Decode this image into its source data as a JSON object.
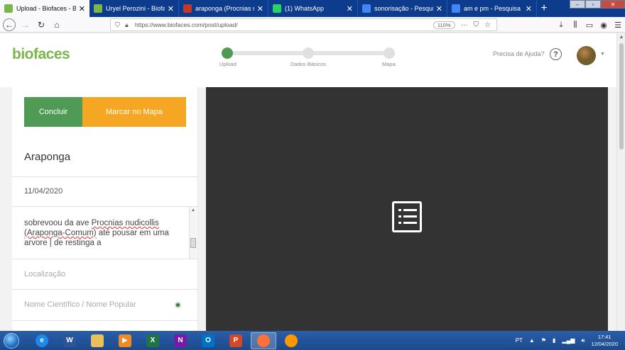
{
  "browser": {
    "tabs": [
      {
        "title": "Upload - Biofaces - Bring",
        "icon": "biofaces-favicon",
        "color": "#7bb64a",
        "active": true
      },
      {
        "title": "Uryel Perozini - Biofaces",
        "icon": "biofaces-favicon",
        "color": "#7bb64a",
        "active": false
      },
      {
        "title": "araponga (Procnias nudic",
        "icon": "bird-favicon",
        "color": "#c0392b",
        "active": false
      },
      {
        "title": "(1) WhatsApp",
        "icon": "whatsapp-favicon",
        "color": "#25d366",
        "active": false
      },
      {
        "title": "sonorisação - Pesquisa Go",
        "icon": "google-favicon",
        "color": "#4285f4",
        "active": false
      },
      {
        "title": "am e pm - Pesquisa Googl",
        "icon": "google-favicon",
        "color": "#4285f4",
        "active": false
      }
    ],
    "url": "https://www.biofaces.com/post/upload/",
    "zoom": "110%"
  },
  "site": {
    "logo": "biofaces",
    "help_text": "Precisa de Ajuda?",
    "steps": [
      {
        "label": "Upload",
        "active": true
      },
      {
        "label": "Dados Básicos",
        "active": false
      },
      {
        "label": "Mapa",
        "active": false
      }
    ]
  },
  "form": {
    "btn_concluir": "Concluir",
    "btn_mapa": "Marcar no Mapa",
    "title": "Araponga",
    "date": "11/04/2020",
    "desc_before": "sobrevoou da ave ",
    "desc_species": "Procnias nudicollis",
    "desc_common": "(Araponga-Comum)",
    "desc_after": " até pousar em uma arvore | de restinga a",
    "location_placeholder": "Localização",
    "scientific_placeholder": "Nome Científico / Nome Popular"
  },
  "taskbar": {
    "apps": [
      {
        "name": "ie",
        "letter": "e",
        "color": "#1e88e5"
      },
      {
        "name": "word",
        "letter": "W",
        "color": "#2b579a"
      },
      {
        "name": "explorer",
        "letter": "",
        "color": "#e8c15c"
      },
      {
        "name": "media",
        "letter": "▶",
        "color": "#f08a24"
      },
      {
        "name": "excel",
        "letter": "X",
        "color": "#217346"
      },
      {
        "name": "onenote",
        "letter": "N",
        "color": "#7719aa"
      },
      {
        "name": "outlook",
        "letter": "O",
        "color": "#0072c6"
      },
      {
        "name": "powerpoint",
        "letter": "P",
        "color": "#d24726"
      },
      {
        "name": "firefox",
        "letter": "",
        "color": "#ff7139"
      },
      {
        "name": "audio",
        "letter": "",
        "color": "#ff9800"
      }
    ],
    "lang": "PT",
    "time": "17:41",
    "date": "12/04/2020"
  },
  "colors": {
    "green": "#4f9b55",
    "orange": "#f5a623",
    "preview_bg": "#333333"
  }
}
